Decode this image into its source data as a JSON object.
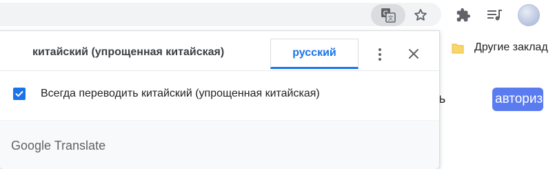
{
  "toolbar": {
    "icons": {
      "translate": "translate-icon",
      "bookmark": "star-icon",
      "extensions": "puzzle-icon",
      "media": "media-playlist-icon",
      "profile": "avatar"
    }
  },
  "bookmarks_bar": {
    "other_bookmarks": "Другие заклад"
  },
  "page": {
    "partial_text": "ить",
    "login_button": "авториз"
  },
  "translate_popup": {
    "source_language": "китайский (упрощенная китайская)",
    "target_language": "русский",
    "always_translate": {
      "label": "Всегда переводить китайский (упрощенная китайская)",
      "checked": true
    },
    "brand": "Google Translate"
  },
  "colors": {
    "accent": "#1a73e8",
    "login_button": "#5b7cf0",
    "footer_bg": "#f8f9fa"
  }
}
